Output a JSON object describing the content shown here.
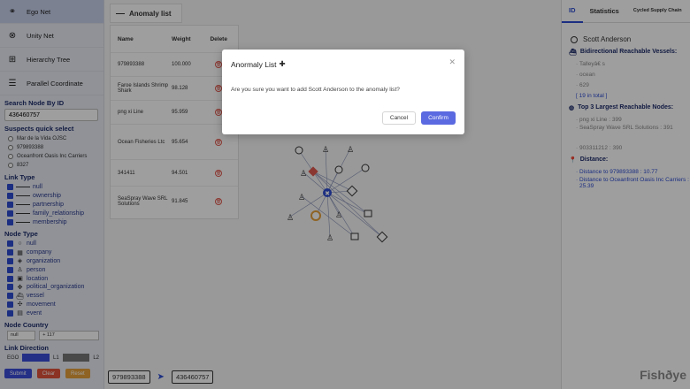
{
  "sidebar": {
    "nav": [
      {
        "label": "Ego Net",
        "icon": "ego-net-icon",
        "active": true
      },
      {
        "label": "Unity Net",
        "icon": "unity-net-icon",
        "active": false
      },
      {
        "label": "Hierarchy Tree",
        "icon": "hierarchy-tree-icon",
        "active": false
      },
      {
        "label": "Parallel Coordinate",
        "icon": "parallel-coordinate-icon",
        "active": false
      }
    ],
    "search_title": "Search Node By ID",
    "search_value": "436460757",
    "suspects_title": "Suspects quick select",
    "suspects": [
      "Mar de la Vida OJSC",
      "979893388",
      "Oceanfront Oasis Inc Carriers",
      "8327"
    ],
    "link_type_title": "Link Type",
    "link_types": [
      "null",
      "ownership",
      "partnership",
      "family_relationship",
      "membership"
    ],
    "node_type_title": "Node Type",
    "node_types": [
      {
        "label": "null",
        "icon": "circle-icon"
      },
      {
        "label": "company",
        "icon": "company-icon"
      },
      {
        "label": "organization",
        "icon": "organization-icon"
      },
      {
        "label": "person",
        "icon": "person-icon"
      },
      {
        "label": "location",
        "icon": "location-icon"
      },
      {
        "label": "political_organization",
        "icon": "political-organization-icon"
      },
      {
        "label": "vessel",
        "icon": "vessel-icon"
      },
      {
        "label": "movement",
        "icon": "movement-icon"
      },
      {
        "label": "event",
        "icon": "event-icon"
      }
    ],
    "country_title": "Node Country",
    "country_select_1": "null",
    "country_select_2": "+ 117",
    "link_direction_title": "Link Direction",
    "dir_ego": "EGO",
    "dir_l1": "L1",
    "dir_l2": "L2",
    "submit_label": "Submit",
    "clear_label": "Clear",
    "reset_label": "Reset"
  },
  "main": {
    "anomaly_tab": "Anomaly list",
    "columns": [
      "Name",
      "Weight",
      "Delete"
    ],
    "rows": [
      {
        "name": "979893388",
        "weight": "100.000"
      },
      {
        "name": "Faroe Islands Shrimp Shark",
        "weight": "98.128"
      },
      {
        "name": "png xi Line",
        "weight": "95.959"
      },
      {
        "name": "Ocean Fisheries Ltc",
        "weight": "95.654"
      },
      {
        "name": "341411",
        "weight": "94.501"
      },
      {
        "name": "SeaSpray Wave SRL Solutions",
        "weight": "91.845"
      }
    ],
    "from_id": "979893388",
    "to_id": "436460757"
  },
  "right": {
    "tabs": [
      "ID",
      "Statistics",
      "Cycled Supply Chain"
    ],
    "name": "Scott Anderson",
    "vessels_title": "Bidirectional Reachable Vessels:",
    "vessels": [
      "Talleyâ€ s",
      "ocean",
      "629"
    ],
    "vessels_total": "[ 19 in total ]",
    "top3_title": "Top 3 Largest Reachable Nodes:",
    "top3": [
      "png xi Line : 399",
      "SeaSpray Wave SRL Solutions : 391",
      "903311212 : 390"
    ],
    "distance_title": "Distance:",
    "distances": [
      "Distance to 979893388 : 10.77",
      "Distance to Oceanfront Oasis Inc Carriers : 25.39"
    ],
    "logo": "Fishðye"
  },
  "modal": {
    "title": "Anormaly List",
    "body": "Are you sure you want to add Scott Anderson to the anomaly list?",
    "cancel": "Cancel",
    "confirm": "Confirm"
  },
  "colors": {
    "accent": "#5b6ae0",
    "checkbox": "#2c4bd1",
    "delete": "#e05a4f",
    "anomaly_node": "#e6a13a"
  }
}
